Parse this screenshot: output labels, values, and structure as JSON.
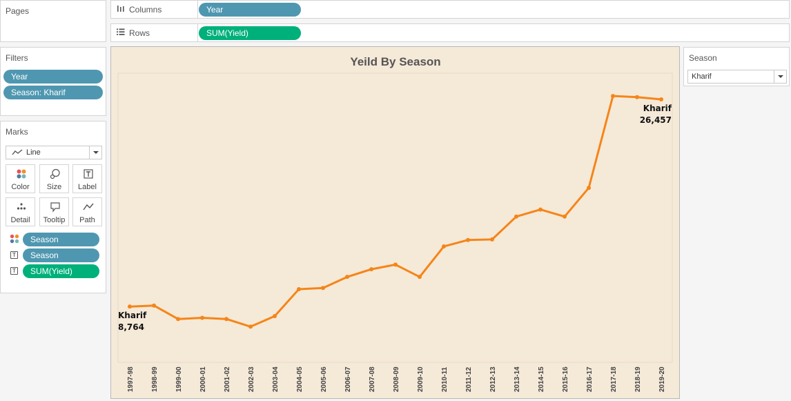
{
  "pages": {
    "title": "Pages"
  },
  "shelves": {
    "columns": {
      "label": "Columns",
      "pill": "Year"
    },
    "rows": {
      "label": "Rows",
      "pill": "SUM(Yield)"
    }
  },
  "filters": {
    "title": "Filters",
    "items": [
      "Year",
      "Season: Kharif"
    ]
  },
  "marks": {
    "title": "Marks",
    "mark_type": "Line",
    "buttons": {
      "color": "Color",
      "size": "Size",
      "label": "Label",
      "detail": "Detail",
      "tooltip": "Tooltip",
      "path": "Path"
    },
    "fields": [
      "Season",
      "Season",
      "SUM(Yield)"
    ]
  },
  "season_filter": {
    "title": "Season",
    "selected": "Kharif"
  },
  "colors": {
    "dimension_pill": "#4f97b0",
    "measure_pill": "#00b07a",
    "line": "#f58518",
    "chart_bg": "#f5e9d8"
  },
  "chart_data": {
    "type": "line",
    "title": "Yeild By Season",
    "x": [
      "1997-98",
      "1998-99",
      "1999-00",
      "2000-01",
      "2001-02",
      "2002-03",
      "2003-04",
      "2004-05",
      "2005-06",
      "2006-07",
      "2007-08",
      "2008-09",
      "2009-10",
      "2010-11",
      "2011-12",
      "2012-13",
      "2013-14",
      "2014-15",
      "2015-16",
      "2016-17",
      "2017-18",
      "2018-19",
      "2019-20"
    ],
    "series": [
      {
        "name": "Kharif",
        "values": [
          8764,
          8850,
          7700,
          7800,
          7700,
          7050,
          7950,
          10250,
          10350,
          11300,
          11950,
          12350,
          11300,
          13900,
          14450,
          14500,
          16450,
          17050,
          16450,
          18900,
          26750,
          26650,
          26457
        ]
      }
    ],
    "labels": [
      {
        "series": "Kharif",
        "index": 0,
        "name": "Kharif",
        "value": "8,764"
      },
      {
        "series": "Kharif",
        "index": 22,
        "name": "Kharif",
        "value": "26,457"
      }
    ],
    "ylim": [
      4000,
      28700
    ],
    "grid": false,
    "legend": "none"
  }
}
